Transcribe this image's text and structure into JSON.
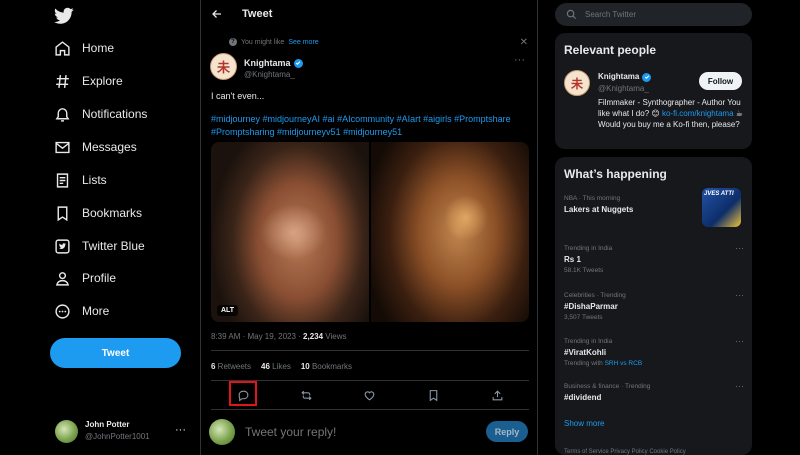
{
  "nav": {
    "items": [
      {
        "label": "Home",
        "icon": "home-icon"
      },
      {
        "label": "Explore",
        "icon": "hashtag-icon"
      },
      {
        "label": "Notifications",
        "icon": "bell-icon"
      },
      {
        "label": "Messages",
        "icon": "envelope-icon"
      },
      {
        "label": "Lists",
        "icon": "list-icon"
      },
      {
        "label": "Bookmarks",
        "icon": "bookmark-icon"
      },
      {
        "label": "Twitter Blue",
        "icon": "twitter-blue-icon"
      },
      {
        "label": "Profile",
        "icon": "person-icon"
      },
      {
        "label": "More",
        "icon": "more-circle-icon"
      }
    ],
    "tweet_button": "Tweet",
    "account": {
      "name": "John Potter",
      "handle": "@JohnPotter1001"
    }
  },
  "center": {
    "header_title": "Tweet",
    "context": {
      "text": "You might like",
      "link": "See more"
    },
    "author": {
      "name": "Knightama",
      "handle": "@Knightama_"
    },
    "text": "I can't even...",
    "hashtags": "#midjourney #midjourneyAI #ai #AIcommunity #AIart #aigirls #Promptshare #Promptsharing #midjourneyv51 #midjourney51",
    "media_alt_badge": "ALT",
    "meta": {
      "time": "8:39 AM · May 19, 2023 · ",
      "views": "2,234",
      "views_label": " Views"
    },
    "stats": [
      {
        "count": "6",
        "label": " Retweets"
      },
      {
        "count": "46",
        "label": " Likes"
      },
      {
        "count": "10",
        "label": " Bookmarks"
      }
    ],
    "reply": {
      "placeholder": "Tweet your reply!",
      "button": "Reply"
    }
  },
  "right": {
    "search_placeholder": "Search Twitter",
    "relevant": {
      "heading": "Relevant people",
      "name": "Knightama",
      "handle": "@Knightama_",
      "follow": "Follow",
      "bio_1": "Filmmaker - Synthographer - Author You like what I do? ",
      "bio_emoji": "😊",
      "bio_link": "ko-fi.com/knightama",
      "bio_emoji_2": "☕",
      "bio_2": " Would you buy me a Ko-fi then, please?"
    },
    "happening": {
      "heading": "What’s happening",
      "trends": [
        {
          "category": "NBA · This morning",
          "title": "Lakers at Nuggets",
          "count": ""
        },
        {
          "category": "Trending in India",
          "title": "Rs 1",
          "count": "58.1K Tweets"
        },
        {
          "category": "Celebrities · Trending",
          "title": "#DishaParmar",
          "count": "3,507 Tweets"
        },
        {
          "category": "Trending in India",
          "title": "#ViratKohli",
          "count_prefix": "Trending with ",
          "count_links": "SRH vs RCB"
        },
        {
          "category": "Business & finance · Trending",
          "title": "#dividend",
          "count": ""
        }
      ],
      "trend_image_text": "JVES ATTI",
      "show_more": "Show more"
    },
    "footer": "Terms of Service   Privacy Policy   Cookie Policy"
  }
}
